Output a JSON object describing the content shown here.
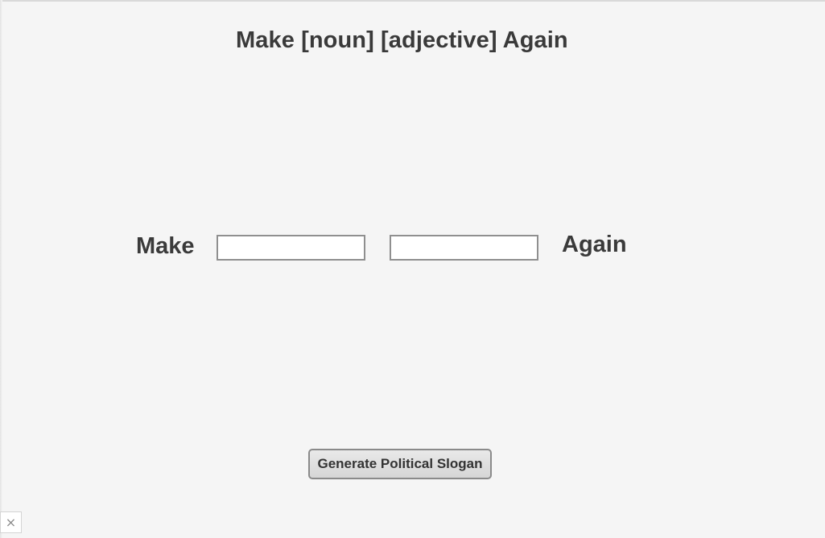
{
  "page": {
    "title": "Make [noun] [adjective] Again"
  },
  "form": {
    "prefix_word": "Make",
    "suffix_word": "Again",
    "noun_input": {
      "value": "",
      "placeholder": ""
    },
    "adjective_input": {
      "value": "",
      "placeholder": ""
    }
  },
  "actions": {
    "generate_label": "Generate Political Slogan"
  },
  "overlay": {
    "close_icon": "close-icon",
    "close_glyph": "×"
  },
  "colors": {
    "background": "#f5f5f5",
    "text": "#3a3a3a",
    "button_face": "#dcdcdc",
    "input_border": "#8f8f8f"
  }
}
